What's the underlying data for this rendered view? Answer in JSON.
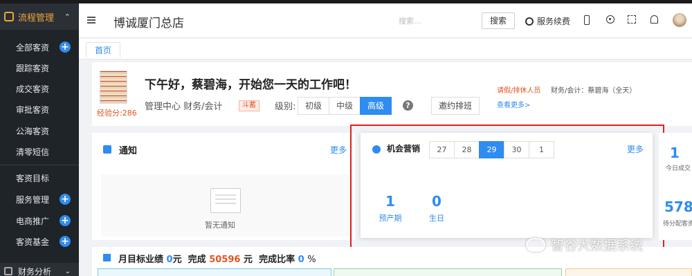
{
  "sidebar": {
    "section_title": "流程管理",
    "items": [
      {
        "label": "全部客资",
        "plus": true
      },
      {
        "label": "跟踪客资",
        "plus": false
      },
      {
        "label": "成交客资",
        "plus": false
      },
      {
        "label": "审批客资",
        "plus": false
      },
      {
        "label": "公海客资",
        "plus": false
      },
      {
        "label": "清零短信",
        "plus": false
      },
      {
        "label": "客资目标",
        "plus": false
      },
      {
        "label": "服务管理",
        "plus": true
      },
      {
        "label": "电商推广",
        "plus": true
      },
      {
        "label": "客资基金",
        "plus": true
      }
    ],
    "footer": "财务分析"
  },
  "header": {
    "title": "博诚厦门总店",
    "search_placeholder": "搜索...",
    "search_button": "搜索",
    "service_label": "服务续费"
  },
  "tabs": [
    "首页"
  ],
  "welcome": {
    "exp": "经验分:286",
    "greeting": "下午好，蔡碧海，开始您一天的工作吧！",
    "subtitle": "管理中心 财务/会计",
    "badge": "斗蓄",
    "level_label": "级别:",
    "levels": [
      "初级",
      "中级",
      "高级"
    ],
    "active_level": "高级",
    "help": "?",
    "invite_button": "邀约排班",
    "leave_link": "请假/排休人员",
    "leave_text": "财务/会计：蔡碧海（全天）",
    "more_link": "查看更多>"
  },
  "notice": {
    "title": "通知",
    "more": "更多",
    "empty_text": "暂无通知"
  },
  "opportunity": {
    "title": "机会营销",
    "dates": [
      "27",
      "28",
      "29",
      "30",
      "1"
    ],
    "active_date": "29",
    "more": "更多",
    "stats": [
      {
        "value": "1",
        "label": "预产期"
      },
      {
        "value": "0",
        "label": "生日"
      }
    ]
  },
  "right_stats": [
    {
      "value": "1",
      "label": "今日成交"
    },
    {
      "value": "578",
      "label": "待分配客资"
    }
  ],
  "monthly": {
    "title": "月目标业绩",
    "target": "0",
    "unit1": "元",
    "complete_label": "完成",
    "complete": "50596",
    "unit2": "元",
    "rate_label": "完成比率",
    "rate": "0",
    "percent": "%"
  },
  "watermark": "智谷大数据系统",
  "colors": {
    "sidebar_bg": "#1f2429",
    "accent": "#2f8cf0",
    "highlight": "#e02020",
    "warning": "#e0551f"
  }
}
